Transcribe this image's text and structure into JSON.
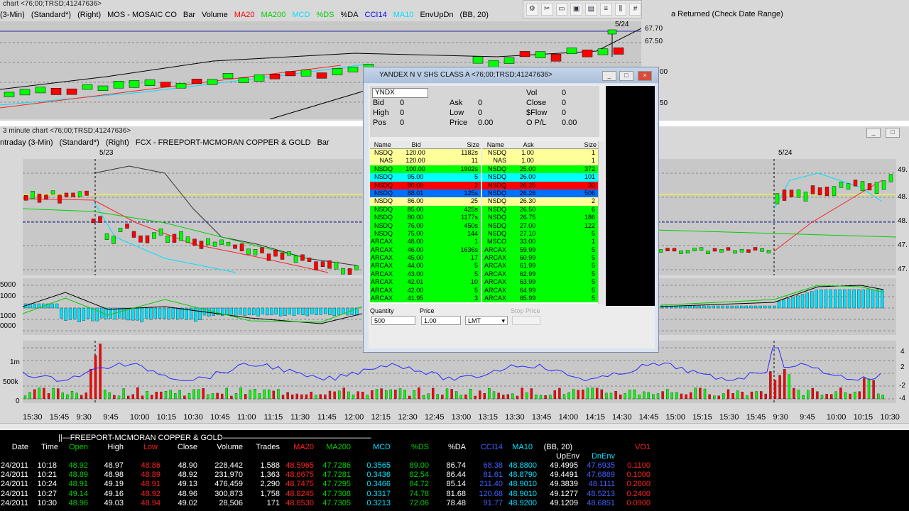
{
  "top_chart": {
    "title": "chart <76;00;TRSD;41247636>",
    "indicator_row": [
      "(3-Min)",
      "(Standard*)",
      "(Right)",
      "MOS - MOSAIC CO",
      "Bar",
      "Volume",
      "MA20",
      "MA200",
      "MCD",
      "%DS",
      "%DA",
      "CCI14",
      "MA10",
      "EnvUpDn",
      "(BB, 20)"
    ],
    "indicator_colors": [
      "#000000",
      "#000000",
      "#000000",
      "#000000",
      "#000000",
      "#000000",
      "#ff0000",
      "#00d000",
      "#00e0ff",
      "#00d000",
      "#000000",
      "#0000ff",
      "#00e0ff",
      "#000000",
      "#000000"
    ],
    "date_marker": "5/24",
    "price_labels": [
      "67.70",
      "67.50",
      "00",
      "50"
    ]
  },
  "right_top": {
    "header": "a Returned   (Check Date Range)"
  },
  "toolbar": {
    "icons": [
      "settings-icon",
      "tools-icon",
      "folder-icon",
      "window-icon",
      "doc-icon",
      "list-icon",
      "columns-icon",
      "grid-icon"
    ]
  },
  "main_chart": {
    "title": "3 minute chart <76;00;TRSD;41247636>",
    "indicator_row": [
      "ntraday (3-Min)",
      "(Standard*)",
      "(Right)",
      "FCX - FREEPORT-MCMORAN COPPER & GOLD",
      "Bar"
    ],
    "date_left": "5/23",
    "date_right": "5/24",
    "price_axis": [
      "49.",
      "48.",
      "48.",
      "47.",
      "47."
    ],
    "osc_axis": [
      "5000",
      "1000",
      "1000",
      "0000"
    ],
    "vol_axis": [
      "1m",
      "500k",
      "0"
    ],
    "right_osc_axis": [
      "4",
      "2",
      "-2",
      "-4"
    ],
    "time_axis": [
      "15:30",
      "15:45",
      "9:30",
      "9:45",
      "10:00",
      "10:15",
      "10:30",
      "10:45",
      "11:00",
      "11:15",
      "11:30",
      "11:45",
      "12:00",
      "12:15",
      "12:30",
      "12:45",
      "13:00",
      "13:15",
      "13:30",
      "13:45",
      "14:00",
      "14:15",
      "14:30",
      "14:45",
      "15:00",
      "15:15",
      "15:30",
      "15:45",
      "9:30",
      "9:45",
      "10:00",
      "10:15",
      "10:30"
    ]
  },
  "level2": {
    "title": "YANDEX N V SHS CLASS A <76;00;TRSD;41247636>",
    "symbol": "YNDX",
    "quote": {
      "bid_label": "Bid",
      "bid": "0",
      "high_label": "High",
      "high": "0",
      "pos_label": "Pos",
      "pos": "0",
      "ask_label": "Ask",
      "ask": "0",
      "low_label": "Low",
      "low": "0",
      "price_label": "Price",
      "price": "0.00",
      "vol_label": "Vol",
      "vol": "0",
      "close_label": "Close",
      "close": "0",
      "sflow_label": "$Flow",
      "sflow": "0",
      "opl_label": "O P/L",
      "opl": "0.00"
    },
    "bid_headers": [
      "Name",
      "Bid",
      "Size"
    ],
    "ask_headers": [
      "Name",
      "Ask",
      "Size"
    ],
    "bids": [
      {
        "name": "NSDQ",
        "price": "120.00",
        "size": "1182s",
        "color": "#ffff99"
      },
      {
        "name": "NAS",
        "price": "120.00",
        "size": "11",
        "color": "#ffff99"
      },
      {
        "name": "NSDQ",
        "price": "100.00",
        "size": "1902s",
        "color": "#00ff00"
      },
      {
        "name": "NSDQ",
        "price": "95.00",
        "size": "5",
        "color": "#00ffff"
      },
      {
        "name": "NSDQ",
        "price": "90.00",
        "size": "2",
        "color": "#ff0000"
      },
      {
        "name": "NSDQ",
        "price": "88.01",
        "size": "125s",
        "color": "#0070ff"
      },
      {
        "name": "NSDQ",
        "price": "86.00",
        "size": "25",
        "color": "#ffff99"
      },
      {
        "name": "NSDQ",
        "price": "85.00",
        "size": "425s",
        "color": "#00ff00"
      },
      {
        "name": "NSDQ",
        "price": "80.00",
        "size": "1177s",
        "color": "#00ff00"
      },
      {
        "name": "NSDQ",
        "price": "76.00",
        "size": "450s",
        "color": "#00ff00"
      },
      {
        "name": "NSDQ",
        "price": "75.00",
        "size": "144",
        "color": "#00ff00"
      },
      {
        "name": "ARCAX",
        "price": "48.00",
        "size": "1",
        "color": "#00ff00"
      },
      {
        "name": "ARCAX",
        "price": "46.00",
        "size": "1636s",
        "color": "#00ff00"
      },
      {
        "name": "ARCAX",
        "price": "45.00",
        "size": "17",
        "color": "#00ff00"
      },
      {
        "name": "ARCAX",
        "price": "44.00",
        "size": "5",
        "color": "#00ff00"
      },
      {
        "name": "ARCAX",
        "price": "43.00",
        "size": "5",
        "color": "#00ff00"
      },
      {
        "name": "ARCAX",
        "price": "42.01",
        "size": "10",
        "color": "#00ff00"
      },
      {
        "name": "ARCAX",
        "price": "42.00",
        "size": "5",
        "color": "#00ff00"
      },
      {
        "name": "ARCAX",
        "price": "41.95",
        "size": "3",
        "color": "#00ff00"
      }
    ],
    "asks": [
      {
        "name": "NSDQ",
        "price": "1.00",
        "size": "1",
        "color": "#ffff99"
      },
      {
        "name": "NAS",
        "price": "1.00",
        "size": "1",
        "color": "#ffff99"
      },
      {
        "name": "NSDQ",
        "price": "25.00",
        "size": "372",
        "color": "#00ff00"
      },
      {
        "name": "NSDQ",
        "price": "26.00",
        "size": "101",
        "color": "#00ffff"
      },
      {
        "name": "NSDQ",
        "price": "26.25",
        "size": "30",
        "color": "#ff0000"
      },
      {
        "name": "NSDQ",
        "price": "26.26",
        "size": "506",
        "color": "#0070ff"
      },
      {
        "name": "NSDQ",
        "price": "26.30",
        "size": "2",
        "color": "#ffff99"
      },
      {
        "name": "NSDQ",
        "price": "26.50",
        "size": "6",
        "color": "#00ff00"
      },
      {
        "name": "NSDQ",
        "price": "26.75",
        "size": "186",
        "color": "#00ff00"
      },
      {
        "name": "NSDQ",
        "price": "27.00",
        "size": "122",
        "color": "#00ff00"
      },
      {
        "name": "NSDQ",
        "price": "27.10",
        "size": "5",
        "color": "#00ff00"
      },
      {
        "name": "MSCO",
        "price": "33.00",
        "size": "1",
        "color": "#00ff00"
      },
      {
        "name": "ARCAX",
        "price": "59.99",
        "size": "5",
        "color": "#00ff00"
      },
      {
        "name": "ARCAX",
        "price": "60.99",
        "size": "5",
        "color": "#00ff00"
      },
      {
        "name": "ARCAX",
        "price": "61.99",
        "size": "5",
        "color": "#00ff00"
      },
      {
        "name": "ARCAX",
        "price": "62.99",
        "size": "5",
        "color": "#00ff00"
      },
      {
        "name": "ARCAX",
        "price": "63.99",
        "size": "5",
        "color": "#00ff00"
      },
      {
        "name": "ARCAX",
        "price": "64.99",
        "size": "5",
        "color": "#00ff00"
      },
      {
        "name": "ARCAX",
        "price": "65.99",
        "size": "5",
        "color": "#00ff00"
      }
    ],
    "order": {
      "quantity_label": "Quantity",
      "quantity": "500",
      "price_label": "Price",
      "price": "1.00",
      "type": "LMT",
      "stop_label": "Stop Price"
    }
  },
  "data_table": {
    "title": "FREEPORT-MCMORAN COPPER & GOLD",
    "headers": [
      "Date",
      "Time",
      "Open",
      "High",
      "Low",
      "Close",
      "Volume",
      "Trades",
      "MA20",
      "MA200",
      "MCD",
      "%DS",
      "%DA",
      "CCI14",
      "MA10",
      "(BB, 20)",
      "VO1"
    ],
    "header_colors": [
      "#ffffff",
      "#ffffff",
      "#00d000",
      "#ffffff",
      "#ff2020",
      "#ffffff",
      "#ffffff",
      "#ffffff",
      "#ff2020",
      "#00d000",
      "#00e0ff",
      "#00d000",
      "#ffffff",
      "#4060ff",
      "#00e0ff",
      "#ffffff",
      "#ff2020"
    ],
    "sub_headers": [
      "UpEnv",
      "DnEnv"
    ],
    "rows": [
      [
        "24/2011",
        "10:18",
        "48.92",
        "48.97",
        "48.86",
        "48.90",
        "228,442",
        "1,588",
        "48.5965",
        "47.7286",
        "0.3565",
        "89.00",
        "86.74",
        "68.38",
        "48.8800",
        "49.4995",
        "47.6935",
        "0.1100"
      ],
      [
        "24/2011",
        "10:21",
        "48.89",
        "48.98",
        "48.89",
        "48.92",
        "231,970",
        "1,363",
        "48.6675",
        "47.7281",
        "0.3436",
        "82.54",
        "86.44",
        "81.61",
        "48.8790",
        "49.4491",
        "47.6869",
        "0.1000"
      ],
      [
        "24/2011",
        "10:24",
        "48.91",
        "49.19",
        "48.91",
        "49.13",
        "476,459",
        "2,290",
        "48.7475",
        "47.7295",
        "0.3466",
        "84.72",
        "85.14",
        "211.40",
        "48.9010",
        "49.3839",
        "48.1111",
        "0.2800"
      ],
      [
        "24/2011",
        "10:27",
        "49.14",
        "49.16",
        "48.92",
        "48.96",
        "300,873",
        "1,758",
        "48.8245",
        "47.7308",
        "0.3317",
        "74.78",
        "81.68",
        "120.68",
        "48.9010",
        "49.1277",
        "48.5213",
        "0.2400"
      ],
      [
        "24/2011",
        "10:30",
        "48.96",
        "49.03",
        "48.94",
        "49.02",
        "28,506",
        "171",
        "48.8530",
        "47.7305",
        "0.3213",
        "72.06",
        "78.48",
        "91.77",
        "48.9200",
        "49.1209",
        "48.6851",
        "0.0900"
      ]
    ]
  }
}
